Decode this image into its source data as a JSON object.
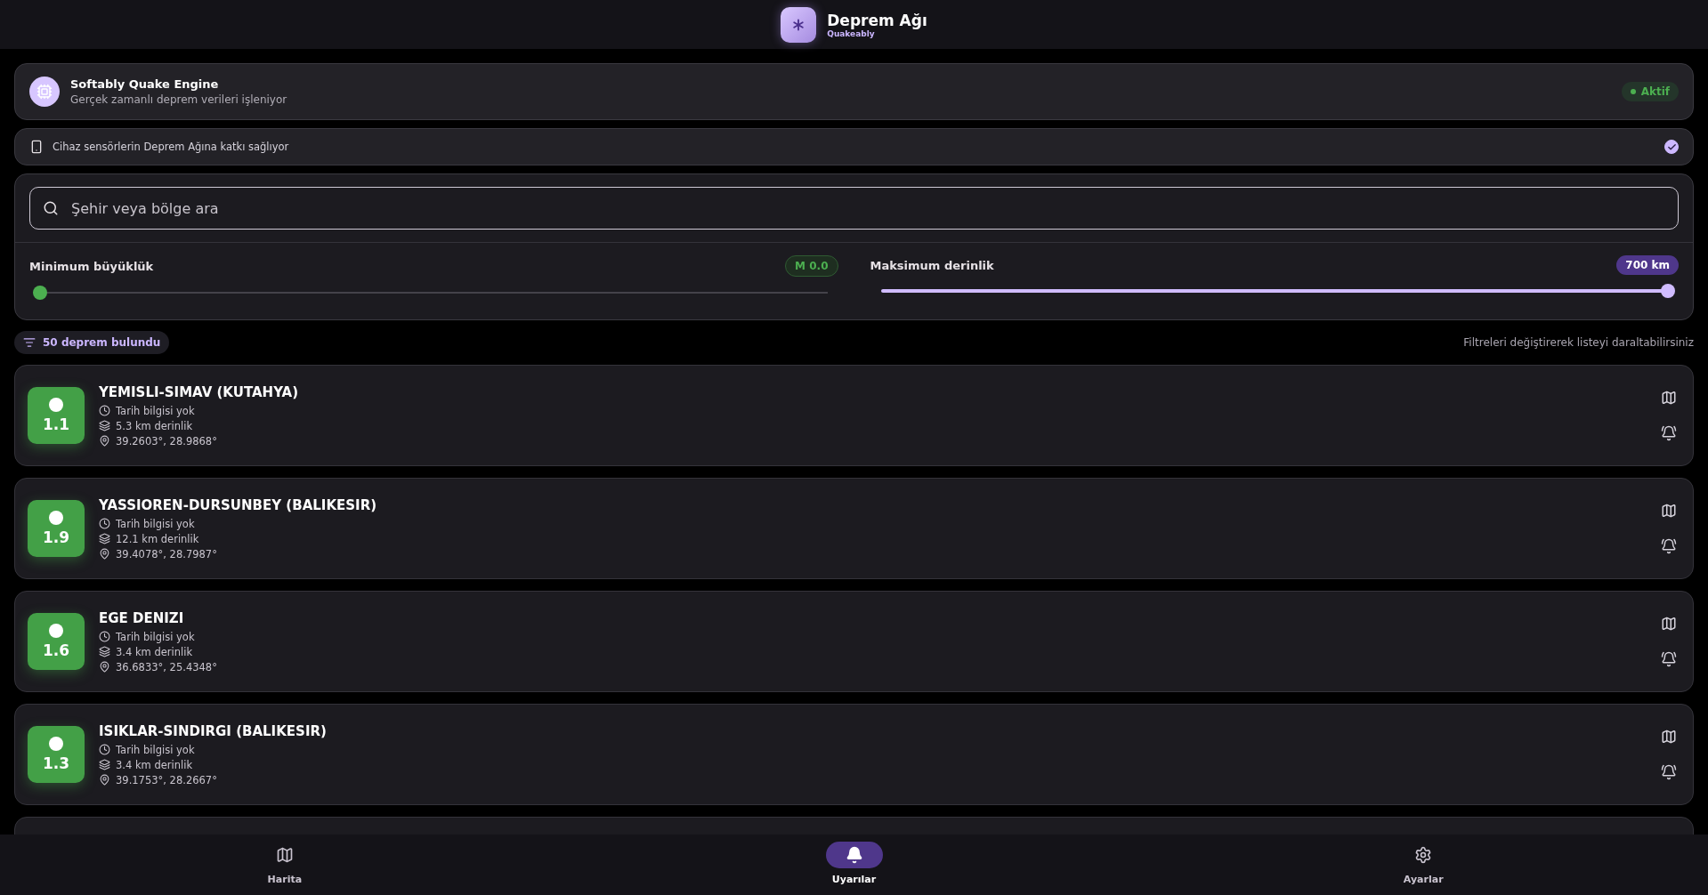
{
  "header": {
    "title": "Deprem Ağı",
    "subtitle": "Quakeably"
  },
  "engine": {
    "title": "Softably Quake Engine",
    "subtitle": "Gerçek zamanlı deprem verileri işleniyor",
    "status": "Aktif",
    "on": true
  },
  "device": {
    "label": "Cihaz sensörlerin Deprem Ağına katkı sağlıyor",
    "checked": true
  },
  "search": {
    "placeholder": "Şehir veya bölge ara"
  },
  "filters": [
    {
      "label": "Minimum büyüklük",
      "reading": "M 0.0",
      "level": 0,
      "color": "#4caf50"
    },
    {
      "label": "Maksimum derinlik",
      "reading": "700 km",
      "level": 1,
      "color": "#d0bcff"
    }
  ],
  "count": "50 deprem bulundu",
  "hint": "Filtreleri değiştirerek listeyi daraltabilirsiniz",
  "quakes": [
    {
      "place": "YEMISLI-SIMAV (KUTAHYA)",
      "magnitude": "1.1",
      "time": "Tarih bilgisi yok",
      "depth": "5.3 km derinlik",
      "coords": "39.2603°, 28.9868°",
      "color": "#43a047"
    },
    {
      "place": "YASSIOREN-DURSUNBEY (BALIKESIR)",
      "magnitude": "1.9",
      "time": "Tarih bilgisi yok",
      "depth": "12.1 km derinlik",
      "coords": "39.4078°, 28.7987°",
      "color": "#43a047"
    },
    {
      "place": "EGE DENIZI",
      "magnitude": "1.6",
      "time": "Tarih bilgisi yok",
      "depth": "3.4 km derinlik",
      "coords": "36.6833°, 25.4348°",
      "color": "#43a047"
    },
    {
      "place": "ISIKLAR-SINDIRGI (BALIKESIR)",
      "magnitude": "1.3",
      "time": "Tarih bilgisi yok",
      "depth": "3.4 km derinlik",
      "coords": "39.1753°, 28.2667°",
      "color": "#43a047"
    }
  ],
  "nav": [
    {
      "label": "Harita",
      "kind": "map",
      "selected": false
    },
    {
      "label": "Uyarılar",
      "kind": "alerts",
      "selected": true
    },
    {
      "label": "Ayarlar",
      "kind": "settings",
      "selected": false
    }
  ]
}
